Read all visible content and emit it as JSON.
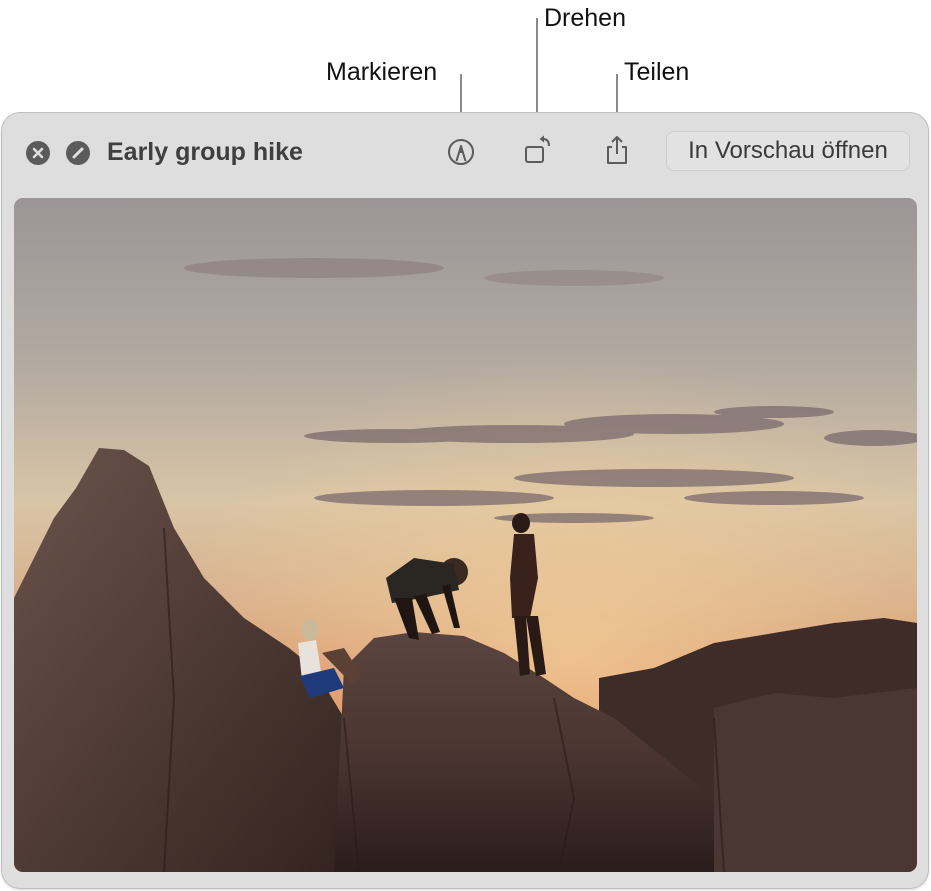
{
  "callouts": {
    "markup": "Markieren",
    "rotate": "Drehen",
    "share": "Teilen"
  },
  "window": {
    "title": "Early group hike",
    "buttons": {
      "close_icon": "close-circle-icon",
      "fullscreen_icon": "fullscreen-circle-icon"
    },
    "toolbar": {
      "markup_icon": "markup-pen-icon",
      "rotate_icon": "rotate-left-icon",
      "share_icon": "share-icon",
      "open_button_label": "In Vorschau öffnen"
    },
    "photo": {
      "description": "Silhouettes of hikers on sandstone rocks at sunset"
    }
  },
  "colors": {
    "window_bg": "#dedede",
    "icon_gray": "#5b5b5b",
    "title_text": "#3f3f3f"
  }
}
